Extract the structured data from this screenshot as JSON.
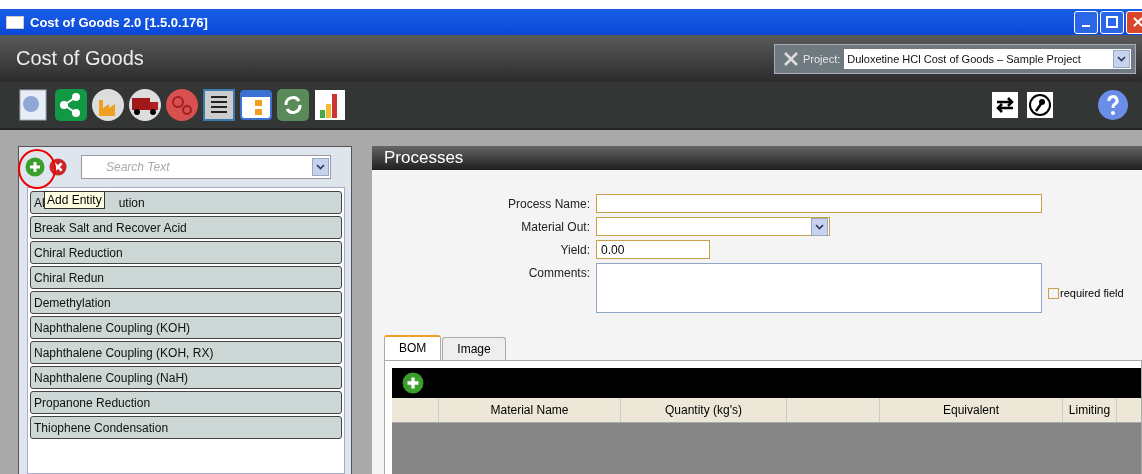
{
  "window": {
    "title": "Cost of Goods 2.0 [1.5.0.176]"
  },
  "header": {
    "app_title": "Cost of Goods",
    "project_label": "Project:",
    "project_value": "Duloxetine HCl Cost of Goods – Sample Project"
  },
  "sidebar": {
    "search_placeholder": "Search Text",
    "tooltip": "Add Entity",
    "add_highlighted": true,
    "items": [
      {
        "label_parts": [
          "Al",
          "ution"
        ]
      },
      {
        "label_parts": [
          "Break Salt and Recover Acid"
        ]
      },
      {
        "label_parts": [
          "Chiral Reduction"
        ]
      },
      {
        "label_parts": [
          "Chiral Redun"
        ]
      },
      {
        "label_parts": [
          "Demethylation"
        ]
      },
      {
        "label_parts": [
          "Naphthalene Coupling (KOH)"
        ]
      },
      {
        "label_parts": [
          "Naphthalene Coupling (KOH, RX)"
        ]
      },
      {
        "label_parts": [
          "Naphthalene Coupling (NaH)"
        ]
      },
      {
        "label_parts": [
          "Propanone Reduction"
        ]
      },
      {
        "label_parts": [
          "Thiophene Condensation"
        ]
      }
    ]
  },
  "panel": {
    "title": "Processes",
    "fields": [
      {
        "kind": "text",
        "label": "Process Name:",
        "required": true
      },
      {
        "kind": "select",
        "label": "Material Out:",
        "required": true
      },
      {
        "kind": "text",
        "label": "Yield:",
        "value": "0.00",
        "required": true,
        "short": true
      },
      {
        "kind": "textarea",
        "label": "Comments:",
        "required": false
      }
    ],
    "legend": "required field",
    "tabs": [
      {
        "label": "BOM",
        "selected": true
      },
      {
        "label": "Image",
        "selected": false
      }
    ],
    "table": {
      "columns": [
        "",
        "Material Name",
        "Quantity (kg's)",
        "",
        "Equivalent",
        "Limiting"
      ]
    }
  }
}
